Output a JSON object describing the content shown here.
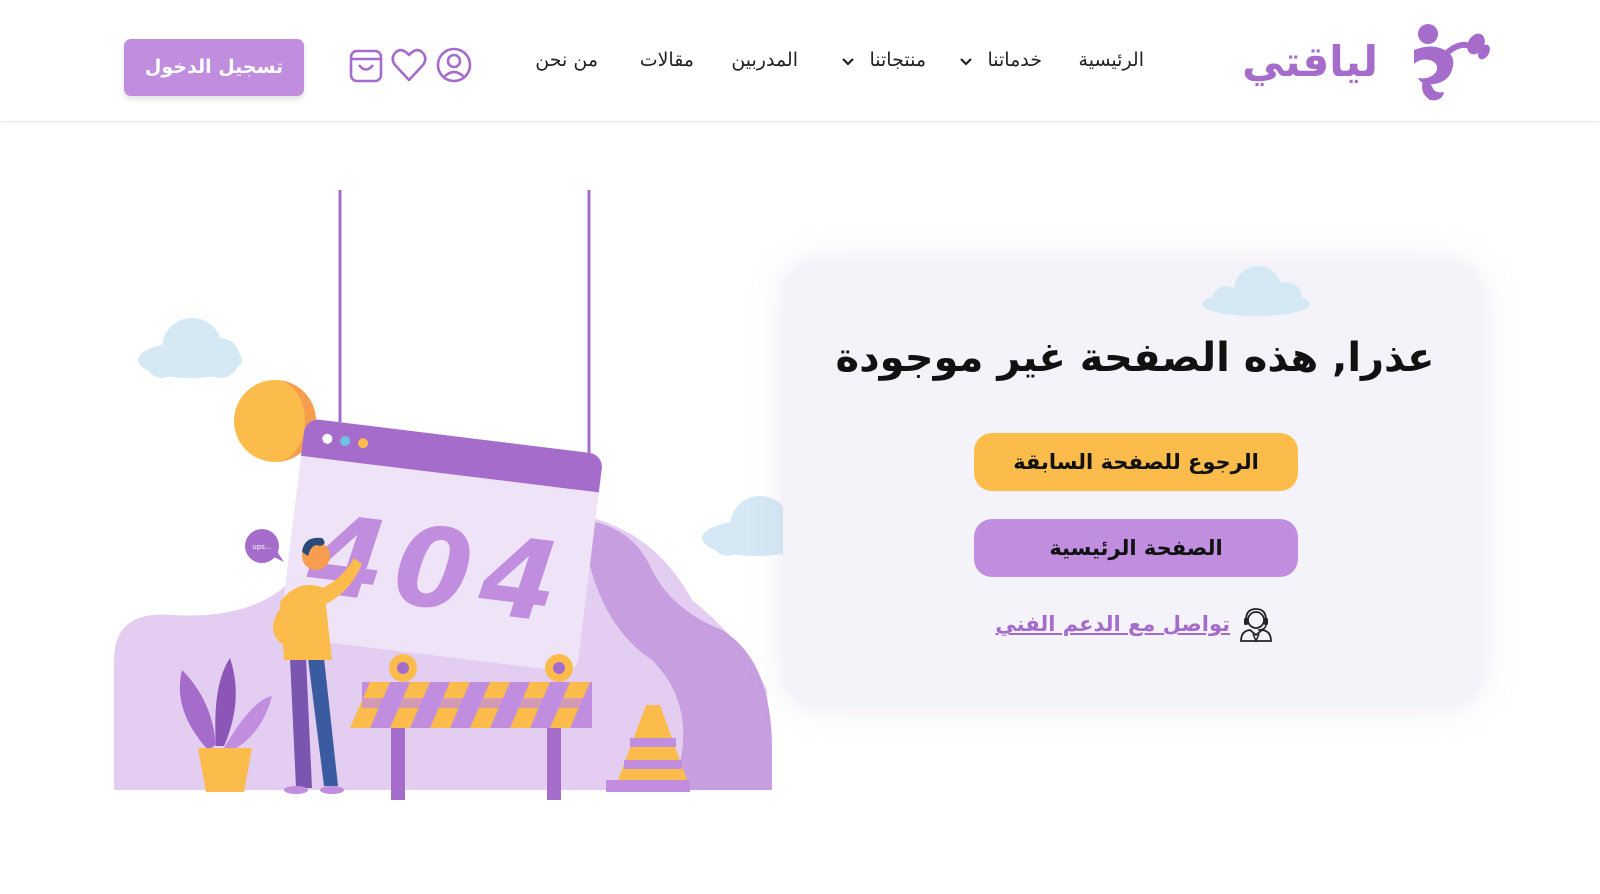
{
  "header": {
    "logo_text": "لياقتي",
    "nav": [
      {
        "label": "الرئيسية",
        "has_dropdown": false
      },
      {
        "label": "خدماتنا",
        "has_dropdown": true
      },
      {
        "label": "منتجاتنا",
        "has_dropdown": true
      },
      {
        "label": "المدربين",
        "has_dropdown": false
      },
      {
        "label": "مقالات",
        "has_dropdown": false
      },
      {
        "label": "من نحن",
        "has_dropdown": false
      }
    ],
    "icons": [
      "user-icon",
      "heart-icon",
      "shopping-bag-icon"
    ],
    "login_label": "تسجيل الدخول"
  },
  "illustration": {
    "error_code": "404",
    "speech_bubble": "ups..."
  },
  "error_card": {
    "title": "عذرا, هذه الصفحة غير موجودة",
    "back_button": "الرجوع للصفحة السابقة",
    "home_button": "الصفحة الرئيسية",
    "support_link": "تواصل مع الدعم الفني",
    "support_icon": "support-agent-icon"
  },
  "colors": {
    "brand_purple": "#a66ccc",
    "button_purple": "#c08ddf",
    "accent_yellow": "#fbbc4c",
    "card_background": "#f5f3fa",
    "cloud_blue": "#d4e9f4"
  }
}
